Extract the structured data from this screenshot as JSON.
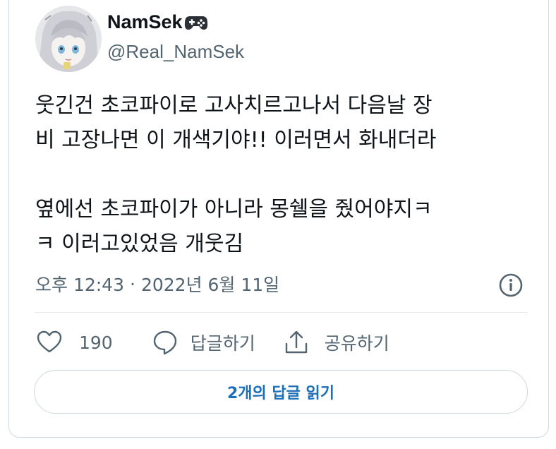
{
  "user": {
    "name": "NamSek",
    "name_emoji": "gamepad-icon",
    "handle": "@Real_NamSek"
  },
  "tweet": {
    "lines": [
      "웃긴건 초코파이로 고사치르고나서 다음날 장",
      "비 고장나면 이 개색기야!! 이러면서 화내더라",
      "",
      "옆에선 초코파이가 아니라 몽쉘을 줬어야지ㅋ",
      "ㅋ 이러고있었음 개웃김"
    ],
    "time": "오후 12:43",
    "separator": "·",
    "date": "2022년 6월 11일"
  },
  "actions": {
    "like_count": "190",
    "reply_label": "답글하기",
    "share_label": "공유하기"
  },
  "read_replies_label": "2개의 답글 읽기",
  "colors": {
    "text": "#0f1419",
    "secondary": "#536471",
    "accent": "#1d6fb8",
    "border": "#cfd9de"
  }
}
